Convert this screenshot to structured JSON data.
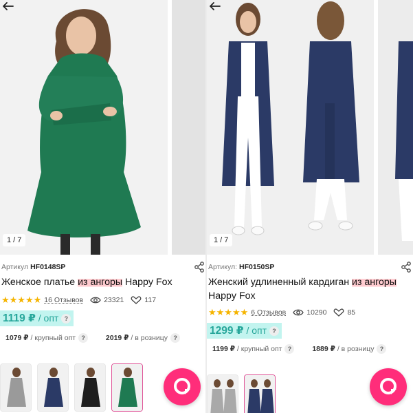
{
  "left": {
    "photo_counter": "1 / 7",
    "sku_label": "Артикул",
    "sku": "HF0148SP",
    "title_before": "Женское платье ",
    "title_highlight": "из ангоры",
    "title_after": " Happy Fox",
    "stars": "★★★★★",
    "reviews": "16 Отзывов",
    "views": "23321",
    "likes": "117",
    "price_main": "1119 ₽",
    "price_main_unit": " / опт",
    "help": "?",
    "price_bulk": "1079 ₽",
    "price_bulk_label": " / крупный опт",
    "price_retail": "2019 ₽",
    "price_retail_label": " / в розницу"
  },
  "right": {
    "photo_counter": "1 / 7",
    "sku_label": "Артикул:",
    "sku": "HF0150SP",
    "title_before": "Женский удлиненный кардиган ",
    "title_highlight": "из ангоры",
    "title_after": " Happy Fox",
    "stars": "★★★★★",
    "reviews": "6 Отзывов",
    "views": "10290",
    "likes": "85",
    "price_main": "1299 ₽",
    "price_main_unit": " / опт",
    "help": "?",
    "price_bulk": "1199 ₽",
    "price_bulk_label": " / крупный опт",
    "price_retail": "1889 ₽",
    "price_retail_label": " / в розницу"
  },
  "colors": {
    "accent_pink": "#ff2d7a",
    "price_teal": "#26a69a",
    "star_yellow": "#f5b400",
    "dress_green": "#1f7a52",
    "cardigan_navy": "#2b3a66"
  },
  "icons": [
    "back-arrow-icon",
    "share-icon",
    "eye-icon",
    "heart-icon",
    "chat-icon"
  ]
}
